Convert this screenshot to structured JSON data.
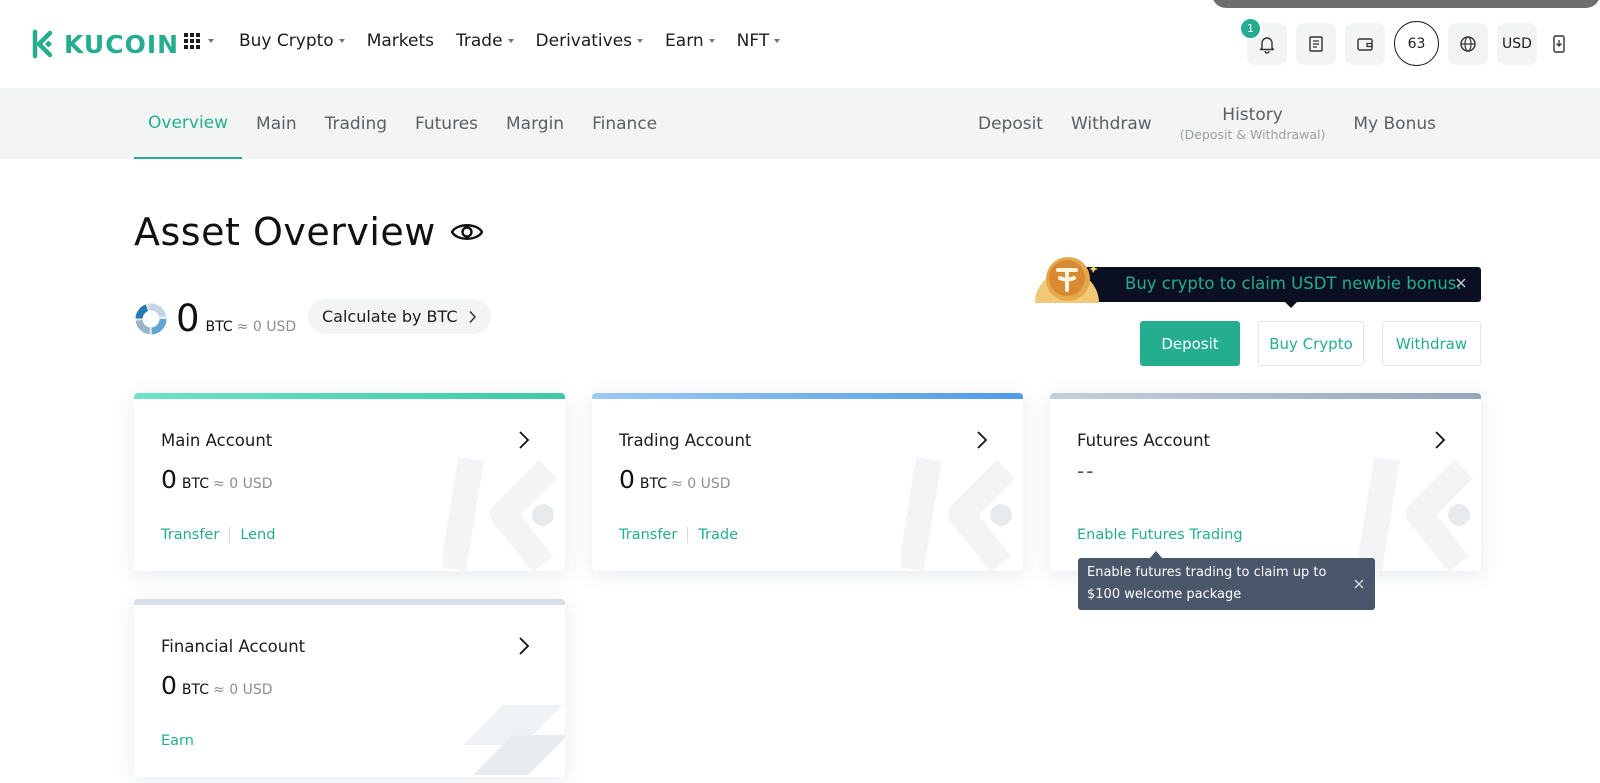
{
  "brand": {
    "name": "KUCOIN",
    "color": "#24ae8f"
  },
  "nav": {
    "apps_icon": "grid-icon",
    "items": [
      {
        "label": "Buy Crypto",
        "dropdown": true
      },
      {
        "label": "Markets",
        "dropdown": false
      },
      {
        "label": "Trade",
        "dropdown": true
      },
      {
        "label": "Derivatives",
        "dropdown": true
      },
      {
        "label": "Earn",
        "dropdown": true
      },
      {
        "label": "NFT",
        "dropdown": true
      }
    ]
  },
  "top_right": {
    "notification_count": "1",
    "avatar_label": "63",
    "currency": "USD",
    "icons": [
      "bell-icon",
      "orders-icon",
      "wallet-icon",
      "globe-icon",
      "download-app-icon"
    ]
  },
  "subnav": {
    "tabs": [
      "Overview",
      "Main",
      "Trading",
      "Futures",
      "Margin",
      "Finance"
    ],
    "active_tab": "Overview",
    "right": {
      "deposit": "Deposit",
      "withdraw": "Withdraw",
      "history": "History",
      "history_sub": "(Deposit & Withdrawal)",
      "bonus": "My Bonus"
    }
  },
  "overview": {
    "title": "Asset Overview",
    "total_value": "0",
    "total_unit": "BTC",
    "total_usd": "≈ 0 USD",
    "calculate_label": "Calculate by BTC"
  },
  "promo": {
    "text": "Buy crypto to claim USDT newbie bonus."
  },
  "actions": {
    "deposit": "Deposit",
    "buy": "Buy Crypto",
    "withdraw": "Withdraw"
  },
  "accounts": [
    {
      "title": "Main Account",
      "value": "0",
      "unit": "BTC",
      "usd": "≈ 0 USD",
      "links": [
        "Transfer",
        "Lend"
      ],
      "bar_color": "#4fd6b9"
    },
    {
      "title": "Trading Account",
      "value": "0",
      "unit": "BTC",
      "usd": "≈ 0 USD",
      "links": [
        "Transfer",
        "Trade"
      ],
      "bar_color": "#6aaef0"
    },
    {
      "title": "Futures Account",
      "placeholder": "--",
      "links": [
        "Enable Futures Trading"
      ],
      "bar_color": "#a6b6c8"
    },
    {
      "title": "Financial Account",
      "value": "0",
      "unit": "BTC",
      "usd": "≈ 0 USD",
      "links": [
        "Earn"
      ],
      "bar_color": "#cdd6e0"
    }
  ],
  "tooltip": {
    "text": "Enable futures trading to claim up to $100 welcome package"
  }
}
